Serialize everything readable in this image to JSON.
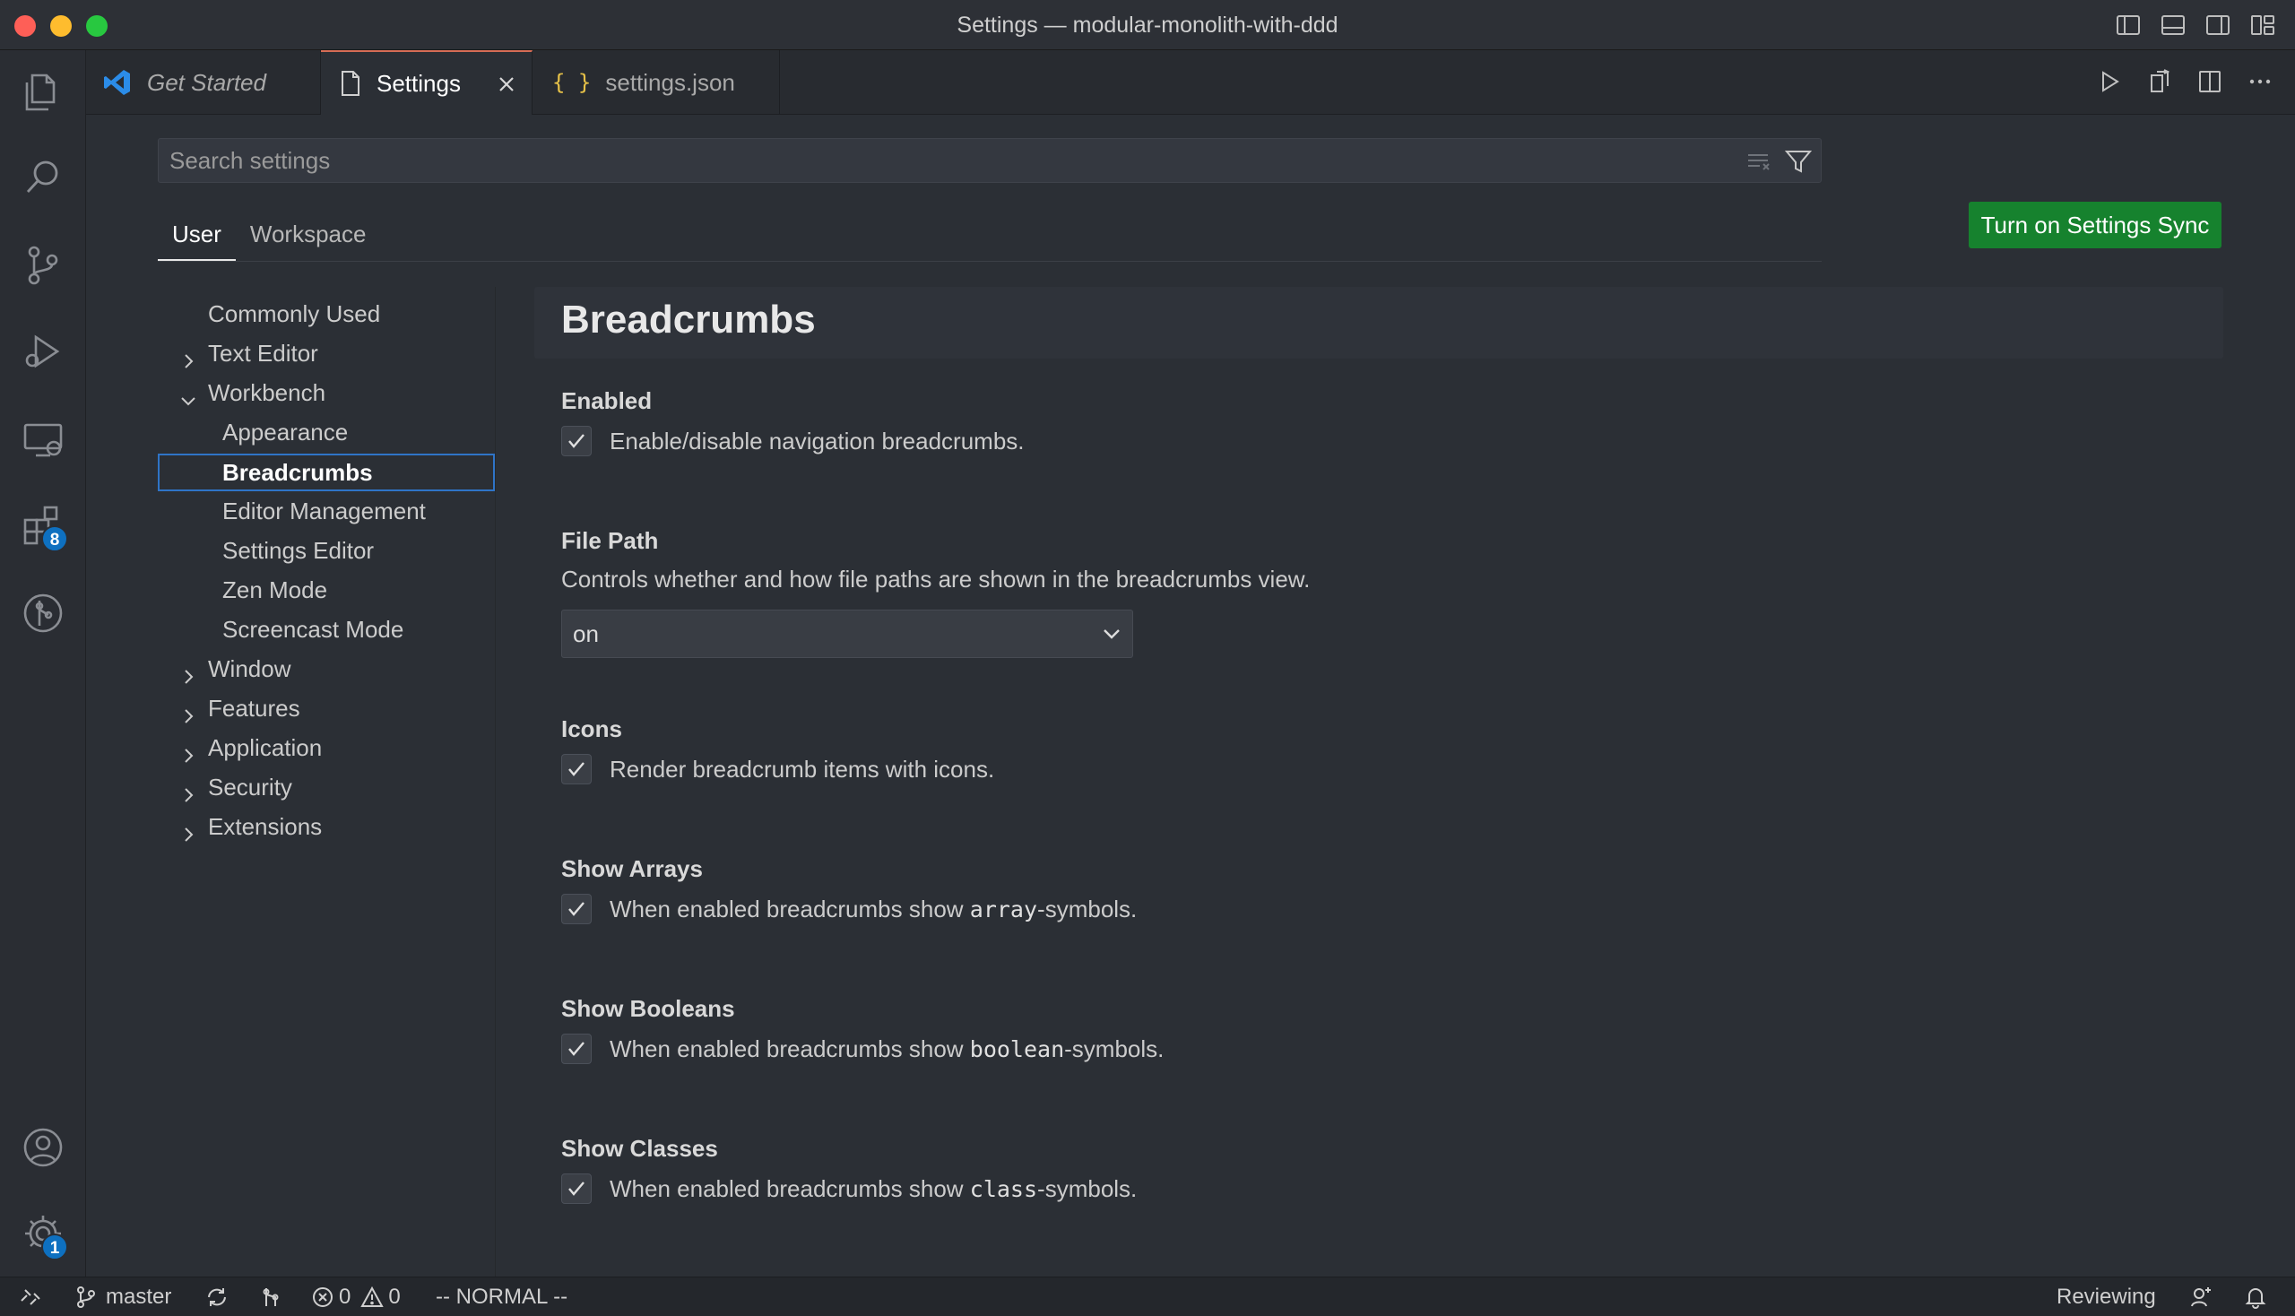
{
  "window": {
    "title": "Settings — modular-monolith-with-ddd"
  },
  "activity_bar": {
    "extensions_badge": "8",
    "manage_badge": "1"
  },
  "tabs": [
    {
      "label": "Get Started"
    },
    {
      "label": "Settings"
    },
    {
      "label": "settings.json"
    }
  ],
  "search": {
    "placeholder": "Search settings"
  },
  "scope_tabs": {
    "user": "User",
    "workspace": "Workspace"
  },
  "sync_button": "Turn on Settings Sync",
  "toc": {
    "commonly_used": "Commonly Used",
    "text_editor": "Text Editor",
    "workbench": "Workbench",
    "appearance": "Appearance",
    "breadcrumbs": "Breadcrumbs",
    "editor_management": "Editor Management",
    "settings_editor": "Settings Editor",
    "zen_mode": "Zen Mode",
    "screencast_mode": "Screencast Mode",
    "window": "Window",
    "features": "Features",
    "application": "Application",
    "security": "Security",
    "extensions": "Extensions"
  },
  "section": {
    "title": "Breadcrumbs"
  },
  "settings": {
    "enabled": {
      "title": "Enabled",
      "desc": "Enable/disable navigation breadcrumbs."
    },
    "file_path": {
      "title": "File Path",
      "desc": "Controls whether and how file paths are shown in the breadcrumbs view.",
      "value": "on"
    },
    "icons": {
      "title": "Icons",
      "desc": "Render breadcrumb items with icons."
    },
    "show_arrays": {
      "title": "Show Arrays",
      "pre": "When enabled breadcrumbs show ",
      "code": "array",
      "post": "-symbols."
    },
    "show_booleans": {
      "title": "Show Booleans",
      "pre": "When enabled breadcrumbs show ",
      "code": "boolean",
      "post": "-symbols."
    },
    "show_classes": {
      "title": "Show Classes",
      "pre": "When enabled breadcrumbs show ",
      "code": "class",
      "post": "-symbols."
    }
  },
  "status_bar": {
    "branch": "master",
    "errors": "0",
    "warnings": "0",
    "mode": "-- NORMAL --",
    "reviewing": "Reviewing"
  },
  "colors": {
    "sync_button_bg": "#16822e",
    "accent_blue": "#2f74c7",
    "active_tab_top": "#d66c55"
  }
}
